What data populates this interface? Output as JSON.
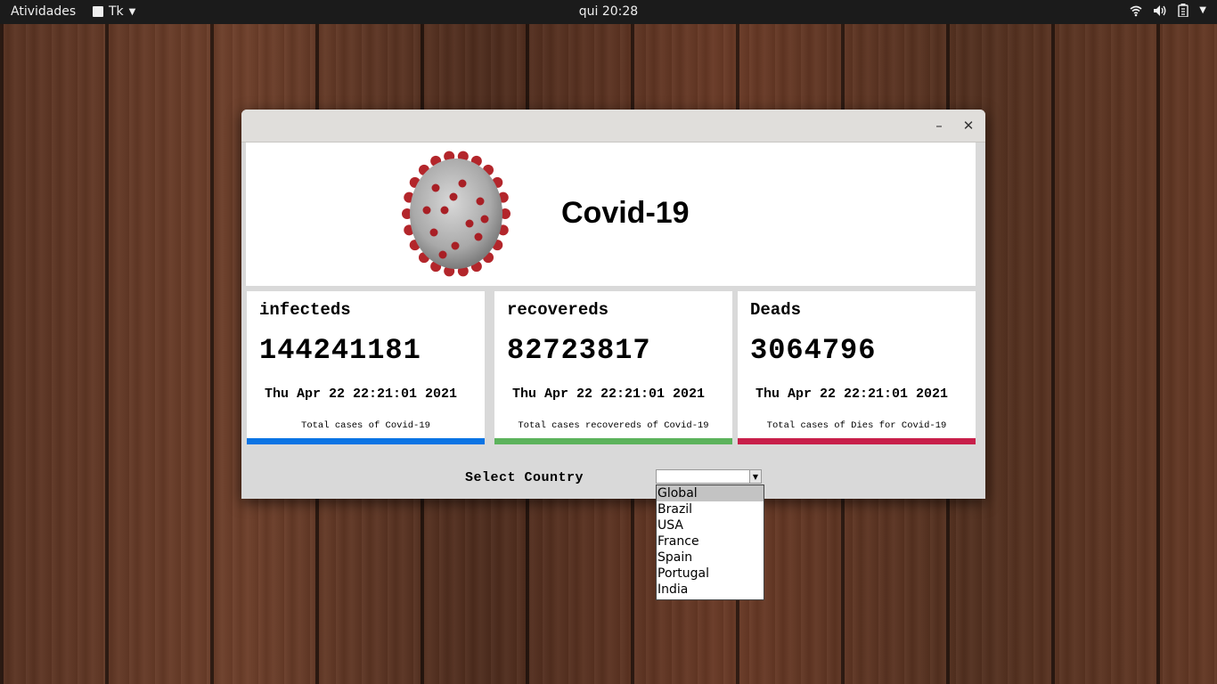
{
  "topbar": {
    "activities": "Atividades",
    "app_name": "Tk",
    "clock": "qui 20:28"
  },
  "window": {
    "title": "Covid-19",
    "minimize_glyph": "–",
    "close_glyph": "✕"
  },
  "cards": [
    {
      "label": "infecteds",
      "value": "144241181",
      "date": "Thu Apr 22 22:21:01 2021",
      "description": "Total cases of Covid-19",
      "color": "#0b74e4"
    },
    {
      "label": "recovereds",
      "value": "82723817",
      "date": "Thu Apr 22 22:21:01 2021",
      "description": "Total cases recovereds of Covid-19",
      "color": "#5cb35c"
    },
    {
      "label": "Deads",
      "value": "3064796",
      "date": "Thu Apr 22 22:21:01 2021",
      "description": "Total cases of Dies for Covid-19",
      "color": "#c81f4a"
    }
  ],
  "country_select": {
    "label": "Select Country",
    "value": "",
    "options": [
      "Global",
      "Brazil",
      "USA",
      "France",
      "Spain",
      "Portugal",
      "India"
    ],
    "highlighted": "Global"
  }
}
